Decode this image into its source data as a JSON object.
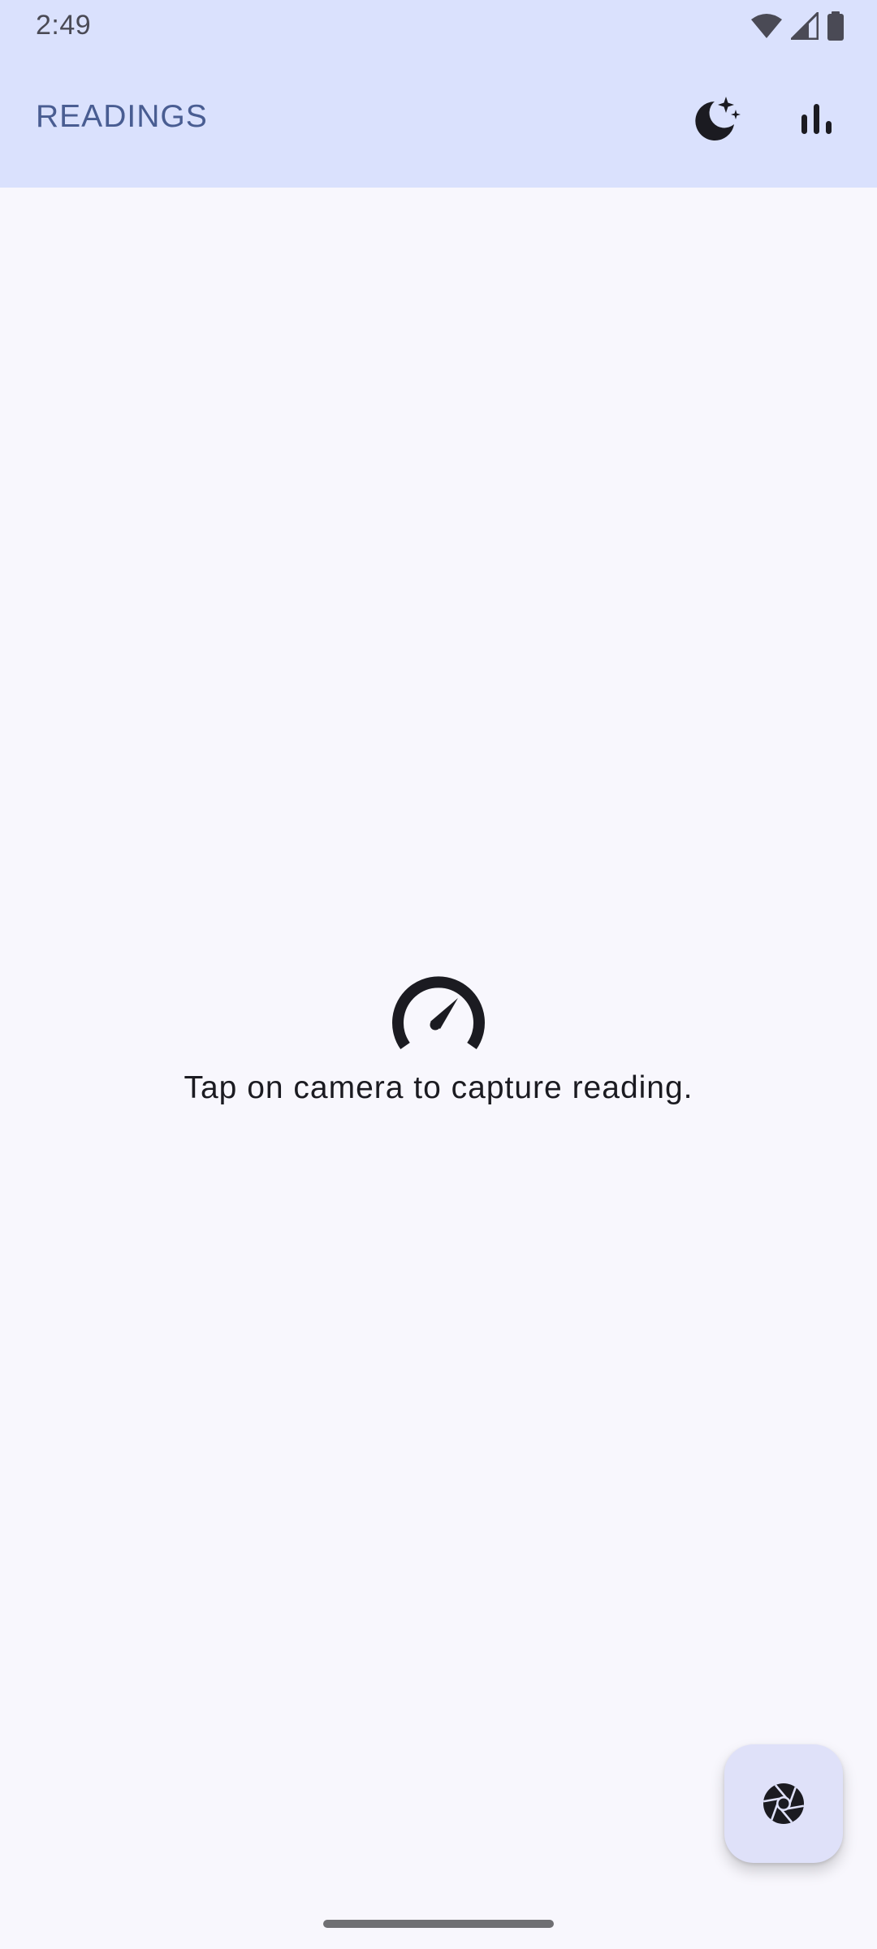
{
  "status_bar": {
    "time": "2:49",
    "icons": [
      "wifi-icon",
      "cell-signal-icon",
      "battery-icon"
    ]
  },
  "app_bar": {
    "title": "READINGS",
    "actions": [
      {
        "name": "dark-mode-icon",
        "description": "theme toggle"
      },
      {
        "name": "bar-chart-icon",
        "description": "statistics"
      }
    ]
  },
  "empty_state": {
    "icon": "speedometer-icon",
    "message": "Tap on camera to capture reading."
  },
  "fab": {
    "icon": "camera-shutter-icon"
  },
  "colors": {
    "header_background": "#dae1fd",
    "title": "#495d92",
    "page_background": "#f8f7fd",
    "fab_background": "#dfe1f9",
    "icon": "#1b1b21"
  }
}
